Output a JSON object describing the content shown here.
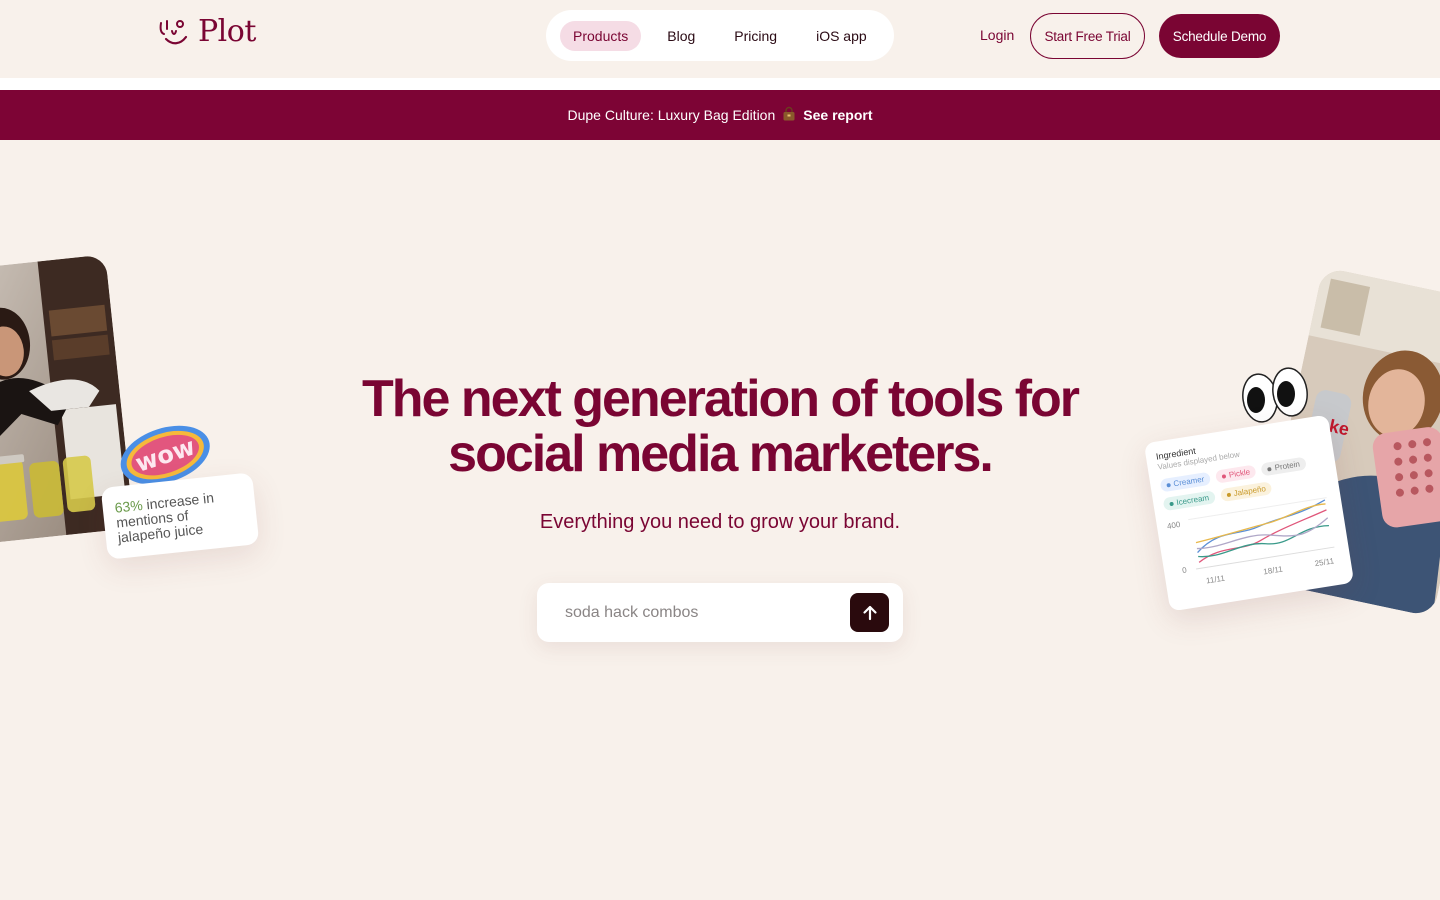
{
  "header": {
    "logo_text": "Plot",
    "nav": [
      {
        "label": "Products",
        "active": true
      },
      {
        "label": "Blog"
      },
      {
        "label": "Pricing"
      },
      {
        "label": "iOS app"
      }
    ],
    "login_label": "Login",
    "trial_label": "Start Free Trial",
    "demo_label": "Schedule Demo"
  },
  "banner": {
    "text": "Dupe Culture: Luxury Bag Edition",
    "icon": "handbag-icon",
    "link_label": "See report"
  },
  "hero": {
    "title_line1": "The next generation of tools for",
    "title_line2": "social media marketers.",
    "subtitle": "Everything you need to grow your brand.",
    "search_placeholder": "soda hack combos"
  },
  "left_card": {
    "sticker": "wow",
    "stat_pct": "63%",
    "stat_line1": "increase in",
    "stat_line2": "mentions of",
    "stat_line3": "jalapeño juice"
  },
  "right_card": {
    "title": "Ingredient",
    "subtitle": "Values displayed below",
    "chips": [
      {
        "label": "Creamer",
        "color": "#5b8fd6",
        "bg": "#e6efff"
      },
      {
        "label": "Pickle",
        "color": "#e0567a",
        "bg": "#fde8ee"
      },
      {
        "label": "Protein",
        "color": "#777777",
        "bg": "#eeeeee"
      },
      {
        "label": "Icecream",
        "color": "#3a9a8a",
        "bg": "#e3f4f0"
      },
      {
        "label": "Jalapeño",
        "color": "#c99a2a",
        "bg": "#fbf2dd"
      }
    ],
    "y_ticks": [
      "400",
      "0"
    ],
    "x_ticks": [
      "11/11",
      "18/11",
      "25/11"
    ]
  },
  "colors": {
    "brand": "#7a0533",
    "banner": "#7d0435",
    "background": "#f8f1eb",
    "active_nav": "#f5dce5"
  }
}
